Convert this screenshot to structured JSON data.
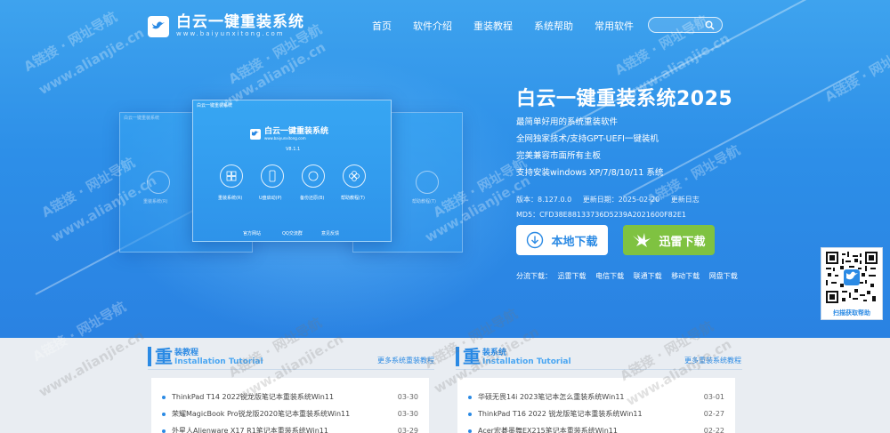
{
  "logo": {
    "title": "白云一键重装系统",
    "subtitle": "www.baiyunxitong.com"
  },
  "nav": [
    "首页",
    "软件介绍",
    "重装教程",
    "系统帮助",
    "常用软件"
  ],
  "search": {
    "placeholder": ""
  },
  "mockup": {
    "window_title": "白云一键重装系统",
    "brand": "白云一键重装系统",
    "brand_sub": "www.baiyunxitong.com",
    "version": "V8.1.1",
    "options": [
      "重装系统(R)",
      "U盘启动(P)",
      "备份还原(B)",
      "帮助教程(T)"
    ],
    "footer": [
      "官方网站",
      "QQ交流群",
      "意见反馈"
    ]
  },
  "product": {
    "title": "白云一键重装系统2025",
    "features": [
      "最简单好用的系统重装软件",
      "全网独家技术/支持GPT-UEFI一键装机",
      "完美兼容市面所有主板",
      "支持安装windows XP/7/8/10/11 系统"
    ],
    "version": "版本：8.127.0.0",
    "update_date": "更新日期：2025-02-20",
    "changelog": "更新日志",
    "md5": "MD5：CFD38E88133736D5239A2021600F82E1"
  },
  "buttons": {
    "local": "本地下载",
    "thunder": "迅雷下载"
  },
  "mirrors": {
    "label": "分流下载：",
    "items": [
      "迅雷下载",
      "电信下载",
      "联通下载",
      "移动下载",
      "网盘下载"
    ]
  },
  "qr": {
    "label": "扫描获取帮助"
  },
  "sections": [
    {
      "big": "重",
      "cn": "装教程",
      "en": "Installation Tutorial",
      "more": "更多系统重装教程",
      "items": [
        {
          "title": "ThinkPad T14 2022锐龙版笔记本重装系统Win11",
          "date": "03-30"
        },
        {
          "title": "荣耀MagicBook Pro锐龙版2020笔记本重装系统Win11",
          "date": "03-30"
        },
        {
          "title": "外星人Alienware X17 R1笔记本重装系统Win11",
          "date": "03-29"
        }
      ]
    },
    {
      "big": "重",
      "cn": "装系统",
      "en": "Installation Tutorial",
      "more": "更多重装系统教程",
      "items": [
        {
          "title": "华硕无畏14i 2023笔记本怎么重装系统Win11",
          "date": "03-01"
        },
        {
          "title": "ThinkPad T16 2022 锐龙版笔记本重装系统Win11",
          "date": "02-27"
        },
        {
          "title": "Acer宏碁墨舞EX215笔记本重装系统Win11",
          "date": "02-22"
        }
      ]
    }
  ],
  "watermark": {
    "line1": "A链接 · 网址导航",
    "line2": "www.alianjie.cn"
  },
  "colors": {
    "hero": "#2d8fe8",
    "accent": "#2b8ae4",
    "thunder": "#7fc241"
  }
}
